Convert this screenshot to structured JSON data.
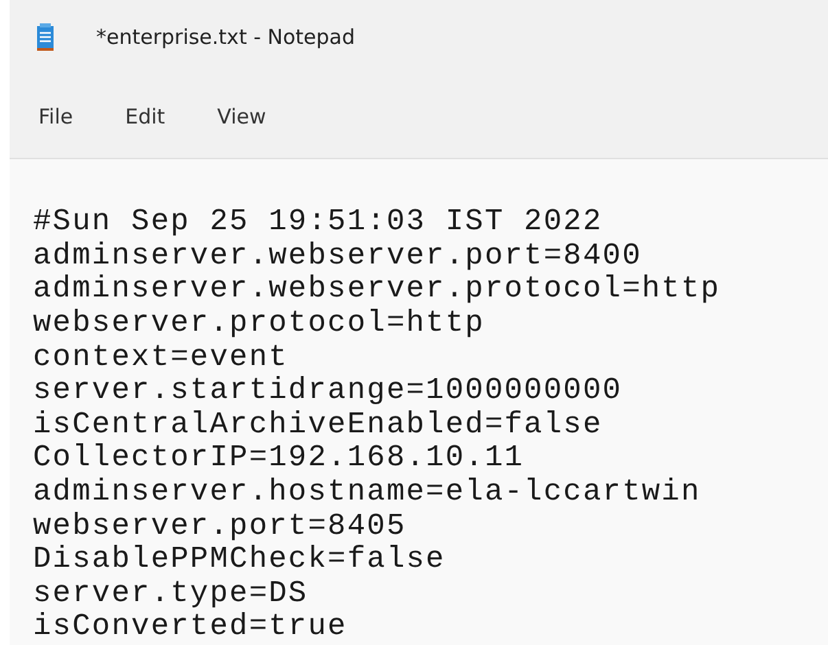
{
  "window": {
    "title": "*enterprise.txt - Notepad"
  },
  "menu": [
    {
      "label": "File"
    },
    {
      "label": "Edit"
    },
    {
      "label": "View"
    }
  ],
  "editor": {
    "lines": [
      "#Sun Sep 25 19:51:03 IST 2022",
      "adminserver.webserver.port=8400",
      "adminserver.webserver.protocol=http",
      "webserver.protocol=http",
      "context=event",
      "server.startidrange=1000000000",
      "isCentralArchiveEnabled=false",
      "CollectorIP=192.168.10.11",
      "adminserver.hostname=ela-lccartwin",
      "webserver.port=8405",
      "DisablePPMCheck=false",
      "server.type=DS",
      "isConverted=true"
    ]
  }
}
